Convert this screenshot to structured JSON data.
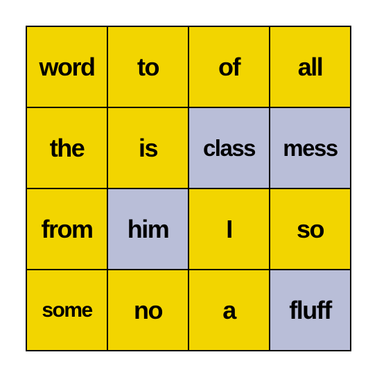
{
  "board": {
    "colors": {
      "unmarked": "#F2D500",
      "marked": "#B9BED8",
      "text": "#000000",
      "grid": "#000000"
    },
    "cells": [
      {
        "word": "word",
        "marked": false
      },
      {
        "word": "to",
        "marked": false
      },
      {
        "word": "of",
        "marked": false
      },
      {
        "word": "all",
        "marked": false
      },
      {
        "word": "the",
        "marked": false
      },
      {
        "word": "is",
        "marked": false
      },
      {
        "word": "class",
        "marked": true
      },
      {
        "word": "mess",
        "marked": true
      },
      {
        "word": "from",
        "marked": false
      },
      {
        "word": "him",
        "marked": true
      },
      {
        "word": "I",
        "marked": false
      },
      {
        "word": "so",
        "marked": false
      },
      {
        "word": "some",
        "marked": false
      },
      {
        "word": "no",
        "marked": false
      },
      {
        "word": "a",
        "marked": false
      },
      {
        "word": "fluff",
        "marked": true
      }
    ]
  }
}
